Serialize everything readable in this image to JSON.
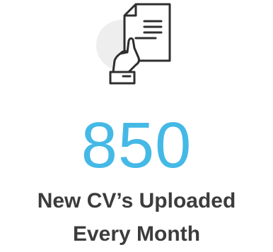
{
  "icon": {
    "name": "hand-holding-document-icon"
  },
  "stat": {
    "number": "850",
    "line1": "New CV’s Uploaded",
    "line2": "Every Month"
  },
  "colors": {
    "accent": "#45b9e6",
    "text": "#3c3c3c",
    "icon_stroke": "#2f2f2f",
    "icon_circle": "#eeeeee"
  }
}
